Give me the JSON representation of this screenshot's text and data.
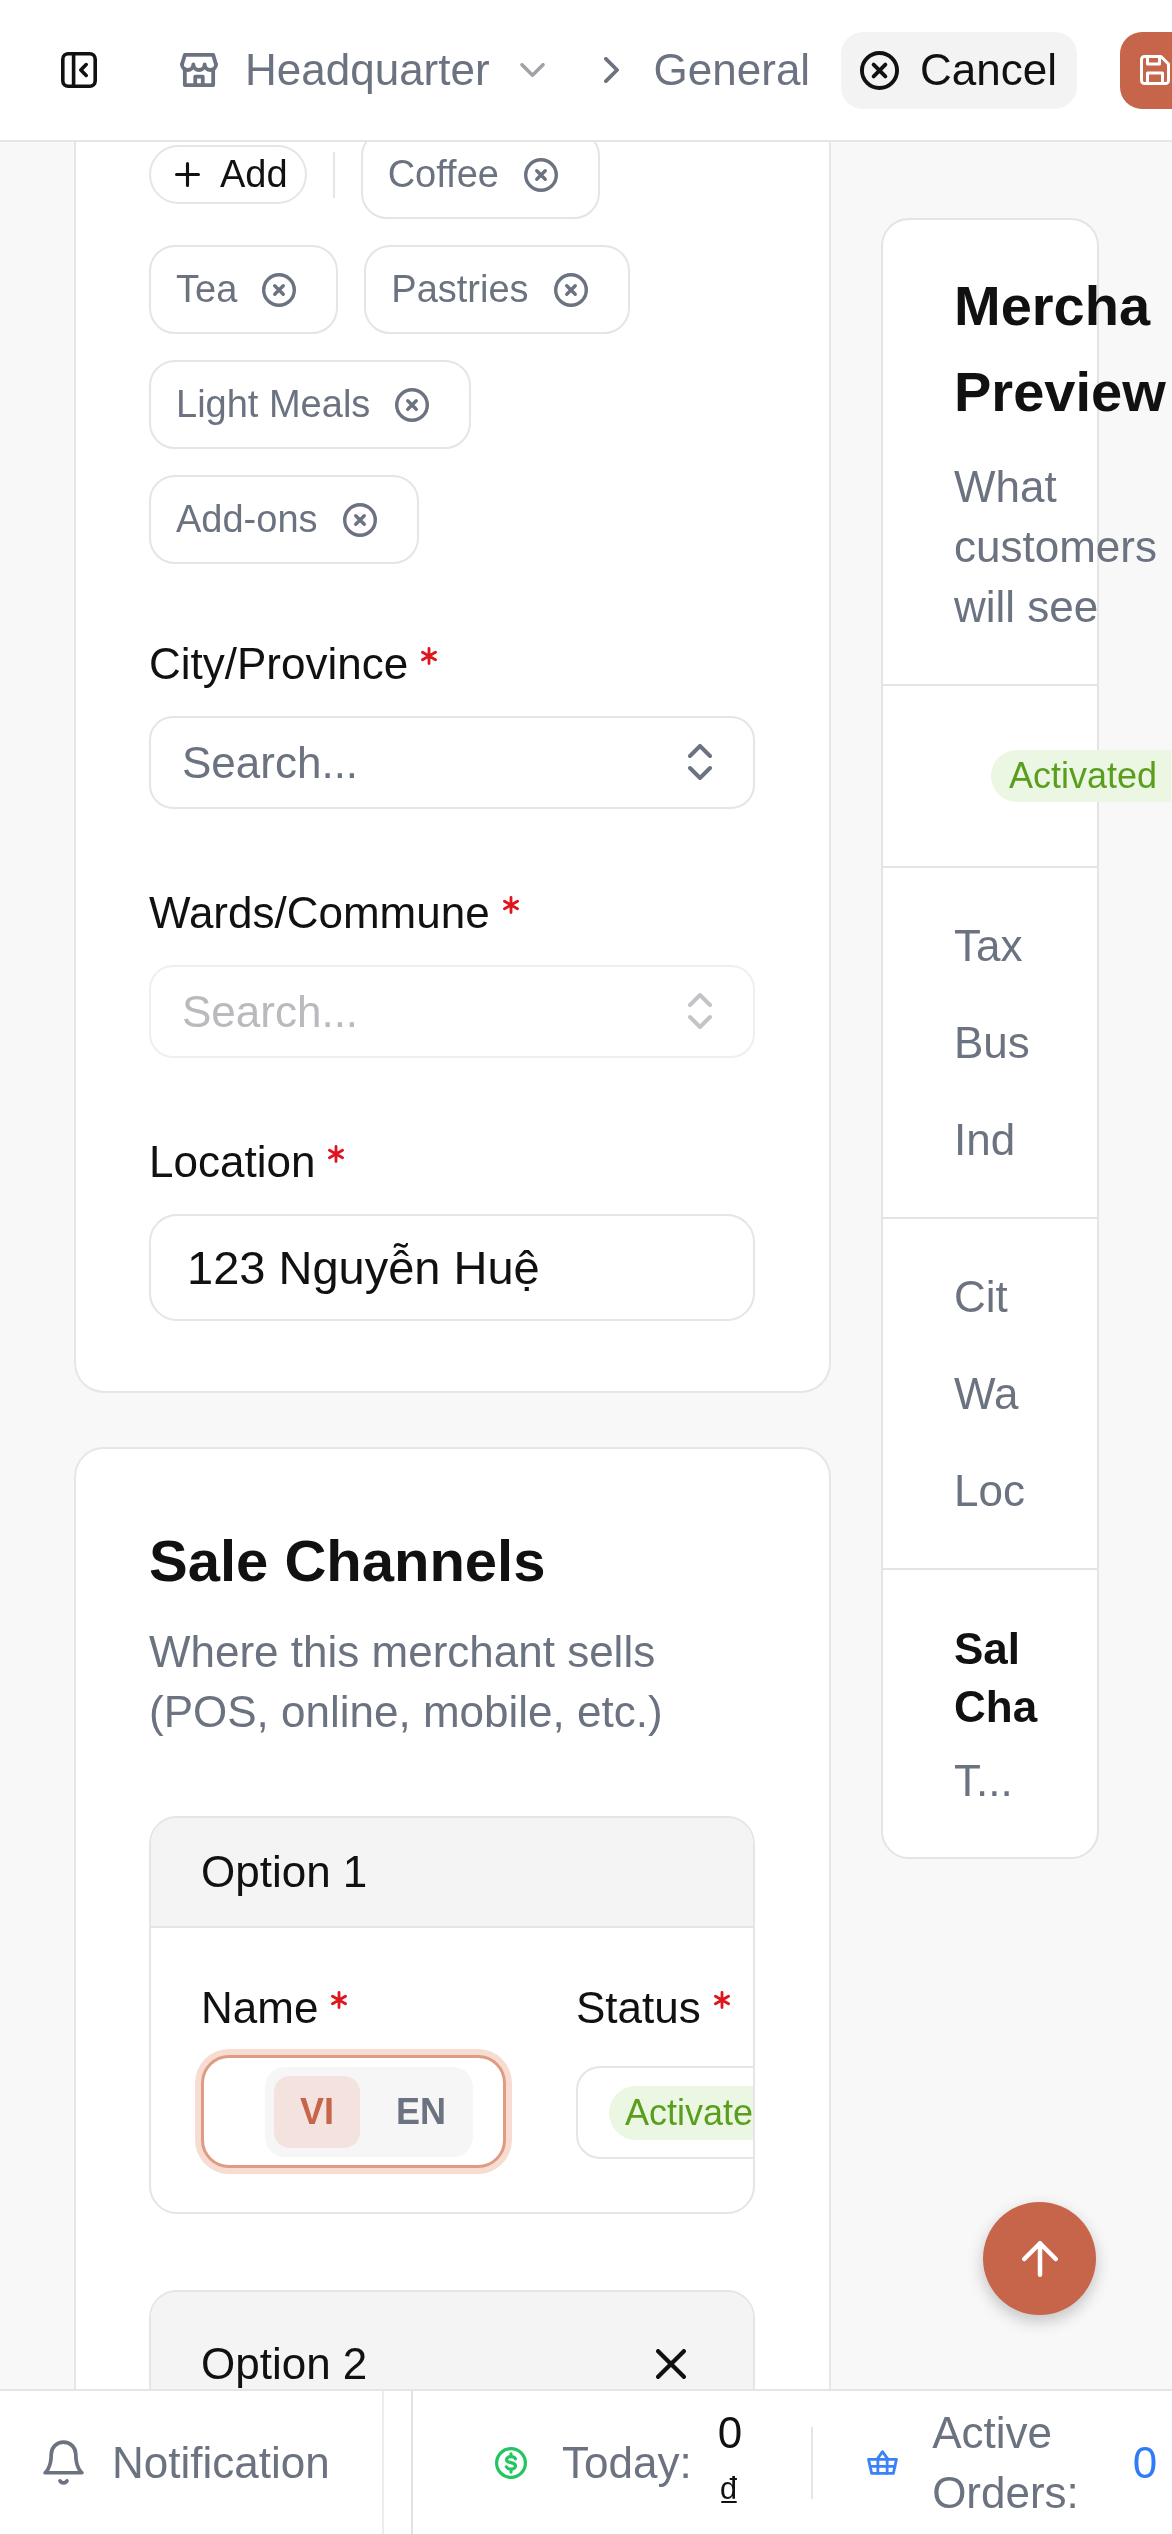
{
  "header": {
    "location": "Headquarter",
    "page": "General",
    "cancel_label": "Cancel"
  },
  "categories": {
    "add_label": "Add",
    "tags": [
      "Coffee",
      "Tea",
      "Pastries",
      "Light Meals",
      "Add-ons"
    ]
  },
  "address_fields": [
    {
      "kind": "select",
      "label": "City/Province",
      "required": true,
      "placeholder": "Search...",
      "disabled": false
    },
    {
      "kind": "select",
      "label": "Wards/Commune",
      "required": true,
      "placeholder": "Search...",
      "disabled": true
    },
    {
      "kind": "text",
      "label": "Location",
      "required": true,
      "value": "123 Nguyễn Huệ"
    }
  ],
  "sale_channels": {
    "title": "Sale Channels",
    "description": "Where this merchant sells (POS, online, mobile, etc.)",
    "options": [
      {
        "title": "Option 1",
        "removable": false,
        "name_field": {
          "label": "Name",
          "required": true,
          "focused": true,
          "languages": [
            {
              "code": "VI",
              "selected": true
            },
            {
              "code": "EN",
              "selected": false
            }
          ]
        },
        "status_field": {
          "label": "Status",
          "required": true,
          "value": "Activate"
        }
      },
      {
        "title": "Option 2",
        "removable": true
      }
    ]
  },
  "preview": {
    "title_lines": [
      "Mercha",
      "Preview"
    ],
    "description": "What customers will see",
    "status": "Activated",
    "detail_groups": [
      [
        "Tax",
        "Bus",
        "Ind"
      ],
      [
        "Cit",
        "Wa",
        "Loc"
      ]
    ],
    "channels": {
      "title_lines": [
        "Sal",
        "Cha"
      ],
      "summary": "T..."
    }
  },
  "bottom_bar": {
    "notification_label": "Notification",
    "stats": [
      {
        "kind": "revenue",
        "label": "Today:",
        "value": "0 ₫"
      },
      {
        "kind": "orders",
        "label": "Active Orders:",
        "value": "0"
      }
    ]
  }
}
